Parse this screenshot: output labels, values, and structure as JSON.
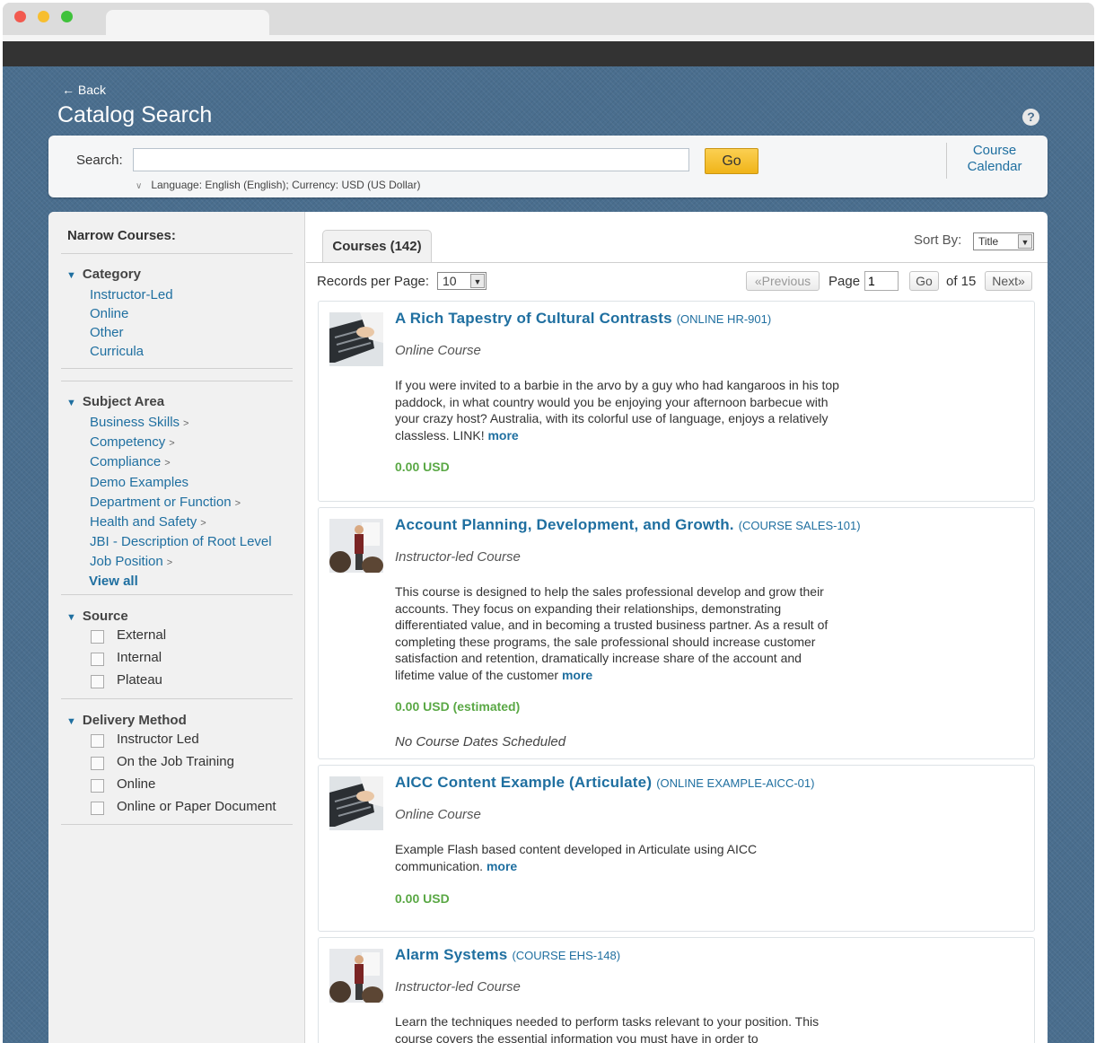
{
  "header": {
    "back": "← Back",
    "title": "Catalog Search",
    "help_icon": "help-icon"
  },
  "search": {
    "label": "Search:",
    "value": "",
    "placeholder": "",
    "go": "Go",
    "language_line": "Language: English (English); Currency: USD (US Dollar)",
    "calendar_link": "Course Calendar"
  },
  "sidebar": {
    "title": "Narrow Courses:",
    "category": {
      "heading": "Category",
      "items": [
        "Instructor-Led",
        "Online",
        "Other",
        "Curricula"
      ]
    },
    "subject_area": {
      "heading": "Subject Area",
      "items": [
        {
          "label": "Business Skills",
          "caret": ">"
        },
        {
          "label": "Competency",
          "caret": ">"
        },
        {
          "label": "Compliance",
          "caret": ">"
        },
        {
          "label": "Demo Examples",
          "caret": ""
        },
        {
          "label": "Department or Function",
          "caret": ">"
        },
        {
          "label": "Health and Safety",
          "caret": ">"
        },
        {
          "label": "JBI - Description of Root Level",
          "caret": ""
        },
        {
          "label": "Job Position",
          "caret": ">"
        }
      ],
      "view_all": "View all"
    },
    "source": {
      "heading": "Source",
      "options": [
        "External",
        "Internal",
        "Plateau"
      ]
    },
    "delivery_method": {
      "heading": "Delivery Method",
      "options": [
        "Instructor Led",
        "On the Job Training",
        "Online",
        "Online or Paper Document"
      ]
    }
  },
  "results": {
    "tab_label": "Courses (142)",
    "sort_label": "Sort By:",
    "sort_value": "Title",
    "records_label": "Records per Page:",
    "records_value": "10",
    "previous": "«Previous",
    "page_label": "Page",
    "page_value": "1",
    "page_go": "Go",
    "of_label": "of 15",
    "next": "Next»",
    "courses": [
      {
        "title": "A Rich Tapestry of Cultural Contrasts",
        "code": "(ONLINE HR-901)",
        "type": "Online Course",
        "thumb": "keyboard-thumbnail",
        "description": "If you were invited to a barbie in the arvo by a guy who had kangaroos in his top paddock, in what country would you be enjoying your afternoon barbecue with your crazy host? Australia, with its colorful use of language, enjoys a relatively classless.   LINK!",
        "more": "more",
        "price": "0.00 USD",
        "dates": ""
      },
      {
        "title": "Account Planning, Development, and Growth.",
        "code": "(COURSE SALES-101)",
        "type": "Instructor-led Course",
        "thumb": "presenter-thumbnail",
        "description": "This course is designed to help the sales professional develop and grow their accounts. They focus on expanding their relationships, demonstrating differentiated value, and in becoming a trusted business partner. As a result of completing these programs, the sale professional should increase customer satisfaction and retention, dramatically increase share of the account and lifetime value of the customer",
        "more": "more",
        "price": "0.00 USD (estimated)",
        "dates": "No Course Dates Scheduled"
      },
      {
        "title": "AICC Content Example (Articulate)",
        "code": "(ONLINE EXAMPLE-AICC-01)",
        "type": "Online Course",
        "thumb": "keyboard-thumbnail",
        "description": "Example Flash based content developed in Articulate using AICC communication.",
        "more": "more",
        "price": "0.00 USD",
        "dates": ""
      },
      {
        "title": "Alarm Systems",
        "code": "(COURSE EHS-148)",
        "type": "Instructor-led Course",
        "thumb": "presenter-thumbnail",
        "description": "Learn the techniques needed to perform tasks relevant to your position. This course covers the essential information you must have in order to",
        "more": "",
        "price": "",
        "dates": ""
      }
    ]
  },
  "colors": {
    "page_background": "#4a6e8e",
    "link_blue": "#1f6fa0",
    "price_green": "#5aa845",
    "go_button": "#f5c235"
  }
}
